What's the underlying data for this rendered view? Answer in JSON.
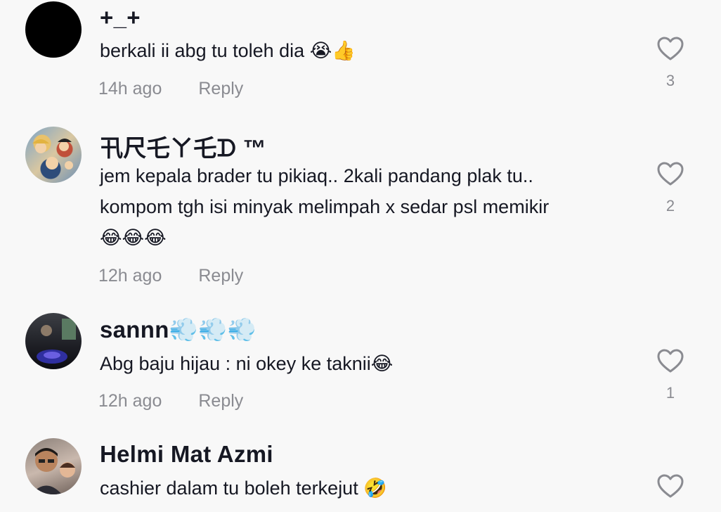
{
  "comments": [
    {
      "username": "+_+",
      "text": "berkali ii abg tu toleh dia 😭👍",
      "time": "14h ago",
      "reply": "Reply",
      "likes": "3",
      "avatar": "black-circle-avatar"
    },
    {
      "username": "卂尺乇ㄚ乇ᗪ ™",
      "text": "jem kepala brader tu pikiaq.. 2kali pandang plak tu..\nkompom tgh isi minyak melimpah x sedar psl memikir\n😂😂😂",
      "time": "12h ago",
      "reply": "Reply",
      "likes": "2",
      "avatar": "anime-group-avatar"
    },
    {
      "username": "sannn💨💨💨",
      "text": "Abg baju hijau : ni okey ke taknii😂",
      "time": "12h ago",
      "reply": "Reply",
      "likes": "1",
      "avatar": "motorbike-night-avatar"
    },
    {
      "username": "Helmi Mat Azmi",
      "text": "cashier dalam tu boleh terkejut 🤣",
      "time": "",
      "reply": "",
      "likes": "",
      "avatar": "man-and-child-avatar"
    }
  ],
  "colors": {
    "background": "#f8f8f8",
    "text": "#161823",
    "meta": "#8a8b91"
  }
}
